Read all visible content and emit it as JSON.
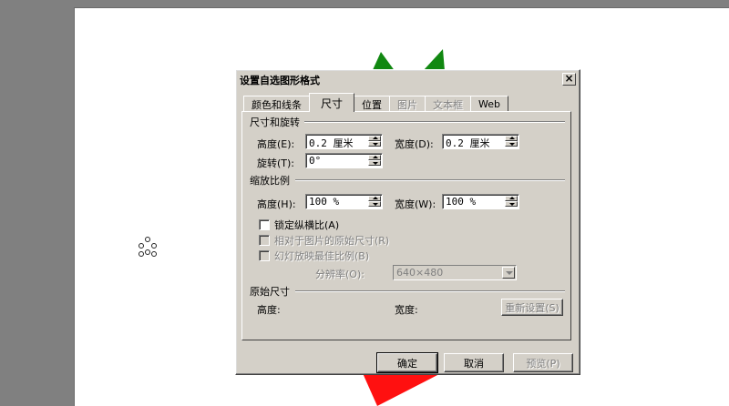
{
  "dialog": {
    "title": "设置自选图形格式",
    "close_label": "×"
  },
  "tabs": [
    {
      "label": "颜色和线条",
      "state": "normal"
    },
    {
      "label": "尺寸",
      "state": "active"
    },
    {
      "label": "位置",
      "state": "normal"
    },
    {
      "label": "图片",
      "state": "disabled"
    },
    {
      "label": "文本框",
      "state": "disabled"
    },
    {
      "label": "Web",
      "state": "normal"
    }
  ],
  "size_rotate": {
    "group_title": "尺寸和旋转",
    "height_label": "高度(E):",
    "height_value": "0.2 厘米",
    "width_label": "宽度(D):",
    "width_value": "0.2 厘米",
    "rotate_label": "旋转(T):",
    "rotate_value": "0°"
  },
  "scale": {
    "group_title": "缩放比例",
    "height_label": "高度(H):",
    "height_value": "100 %",
    "width_label": "宽度(W):",
    "width_value": "100 %",
    "lock_aspect": "锁定纵横比(A)",
    "relative_original": "相对于图片的原始尺寸(R)",
    "best_scale": "幻灯放映最佳比例(B)",
    "resolution_label": "分辨率(O):",
    "resolution_value": "640×480"
  },
  "original": {
    "group_title": "原始尺寸",
    "height_label": "高度:",
    "width_label": "宽度:",
    "reset_label": "重新设置(S)"
  },
  "buttons": {
    "ok": "确定",
    "cancel": "取消",
    "preview": "预览(P)"
  },
  "colors": {
    "dialog_bg": "#d4d0c8",
    "shape_green": "#118811",
    "shape_red": "#ff1010"
  }
}
